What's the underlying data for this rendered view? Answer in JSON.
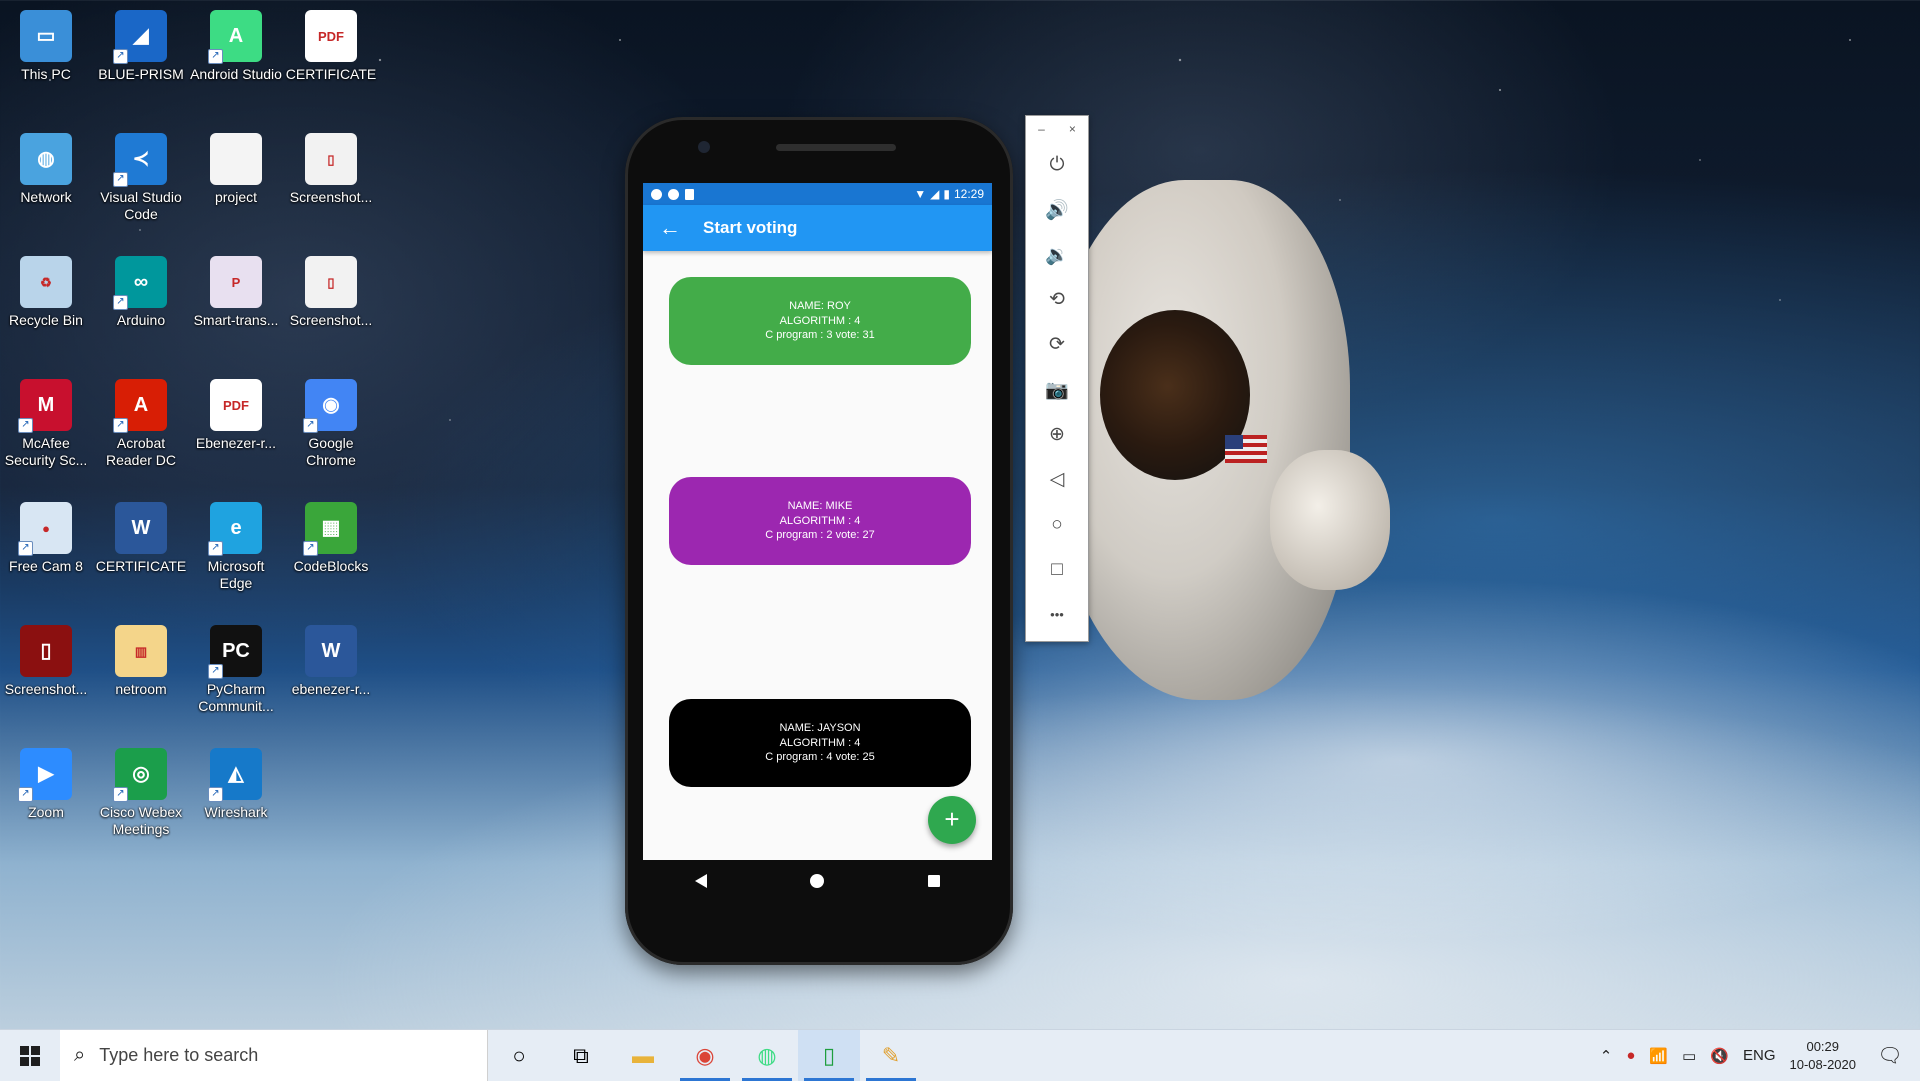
{
  "desktop": {
    "icons": [
      {
        "label": "This PC",
        "color": "#3a8fd8",
        "glyph": "▭",
        "shortcut": false
      },
      {
        "label": "BLUE-PRISM",
        "color": "#1a67c7",
        "glyph": "◢",
        "shortcut": true
      },
      {
        "label": "Android Studio",
        "color": "#3ddc84",
        "glyph": "A",
        "shortcut": true
      },
      {
        "label": "CERTIFICATE",
        "color": "#ffffff",
        "glyph": "PDF",
        "shortcut": false
      },
      {
        "label": "Network",
        "color": "#4aa3df",
        "glyph": "◍",
        "shortcut": false
      },
      {
        "label": "Visual Studio Code",
        "color": "#1f7ad4",
        "glyph": "≺",
        "shortcut": true
      },
      {
        "label": "project",
        "color": "#f4f4f4",
        "glyph": "",
        "shortcut": false
      },
      {
        "label": "Screenshot...",
        "color": "#f2f2f2",
        "glyph": "▯",
        "shortcut": false
      },
      {
        "label": "Recycle Bin",
        "color": "#b9d4ea",
        "glyph": "♻",
        "shortcut": false
      },
      {
        "label": "Arduino",
        "color": "#00979c",
        "glyph": "∞",
        "shortcut": true
      },
      {
        "label": "Smart-trans...",
        "color": "#e8e0f0",
        "glyph": "P",
        "shortcut": false
      },
      {
        "label": "Screenshot...",
        "color": "#f2f2f2",
        "glyph": "▯",
        "shortcut": false
      },
      {
        "label": "McAfee Security Sc...",
        "color": "#c8102e",
        "glyph": "M",
        "shortcut": true
      },
      {
        "label": "Acrobat Reader DC",
        "color": "#d81e05",
        "glyph": "A",
        "shortcut": true
      },
      {
        "label": "Ebenezer-r...",
        "color": "#ffffff",
        "glyph": "PDF",
        "shortcut": false
      },
      {
        "label": "Google Chrome",
        "color": "#4285f4",
        "glyph": "◉",
        "shortcut": true
      },
      {
        "label": "Free Cam 8",
        "color": "#d8e6f3",
        "glyph": "●",
        "shortcut": true
      },
      {
        "label": "CERTIFICATE",
        "color": "#2b579a",
        "glyph": "W",
        "shortcut": false
      },
      {
        "label": "Microsoft Edge",
        "color": "#1fa3e0",
        "glyph": "e",
        "shortcut": true
      },
      {
        "label": "CodeBlocks",
        "color": "#3aa63a",
        "glyph": "▦",
        "shortcut": true
      },
      {
        "label": "Screenshot...",
        "color": "#8b1010",
        "glyph": "▯",
        "shortcut": false
      },
      {
        "label": "netroom",
        "color": "#f4d58a",
        "glyph": "▥",
        "shortcut": false
      },
      {
        "label": "PyCharm Communit...",
        "color": "#111111",
        "glyph": "PC",
        "shortcut": true
      },
      {
        "label": "ebenezer-r...",
        "color": "#2b579a",
        "glyph": "W",
        "shortcut": false
      },
      {
        "label": "Zoom",
        "color": "#2d8cff",
        "glyph": "▶",
        "shortcut": true
      },
      {
        "label": "Cisco Webex Meetings",
        "color": "#1b9e4b",
        "glyph": "◎",
        "shortcut": true
      },
      {
        "label": "Wireshark",
        "color": "#1679c9",
        "glyph": "◭",
        "shortcut": true
      }
    ]
  },
  "phone": {
    "status_bar": {
      "time": "12:29"
    },
    "app_bar": {
      "back_icon": "arrow-back",
      "title": "Start voting"
    },
    "candidates": [
      {
        "name": "NAME: ROY",
        "algorithm": "ALGORITHM : 4",
        "c_program": "C program : 3 vote: 31",
        "color": "#43ac49"
      },
      {
        "name": "NAME: MIKE",
        "algorithm": "ALGORITHM : 4",
        "c_program": "C program : 2 vote: 27",
        "color": "#9c27b0"
      },
      {
        "name": "NAME: JAYSON",
        "algorithm": "ALGORITHM : 4",
        "c_program": "C program : 4 vote: 25",
        "color": "#000000"
      }
    ],
    "fab_label": "+"
  },
  "emulator_toolbar": {
    "minimize": "–",
    "close": "×",
    "buttons": [
      "power-icon",
      "volume-up-icon",
      "volume-down-icon",
      "rotate-left-icon",
      "rotate-right-icon",
      "camera-icon",
      "zoom-icon",
      "back-icon",
      "home-icon",
      "overview-icon",
      "more-icon"
    ],
    "glyphs": [
      "⏻",
      "🔊",
      "🔉",
      "⟲",
      "⟳",
      "📷",
      "⊕",
      "◁",
      "○",
      "□",
      "•••"
    ]
  },
  "taskbar": {
    "search_placeholder": "Type here to search",
    "language": "ENG",
    "time": "00:29",
    "date": "10-08-2020"
  }
}
